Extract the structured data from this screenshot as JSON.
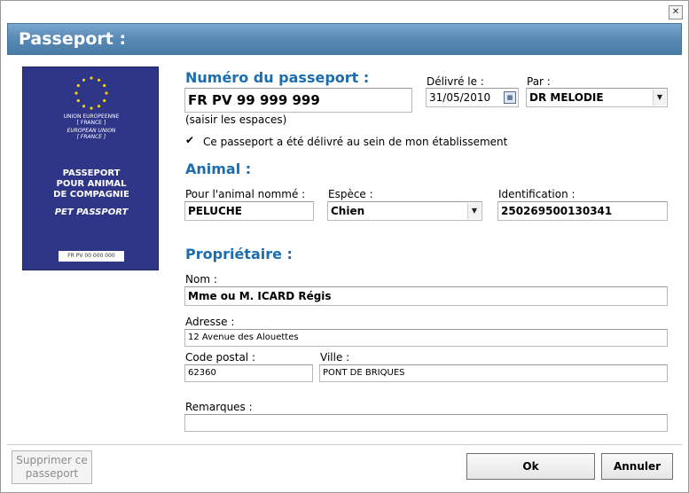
{
  "window": {
    "title": "Passeport :",
    "close_icon": "close-icon"
  },
  "passport_image": {
    "union_fr_1": "UNION EUROPEENNE",
    "union_fr_2": "[ FRANCE ]",
    "union_en_1": "EUROPEAN UNION",
    "union_en_2": "[ FRANCE ]",
    "title_1": "PASSEPORT",
    "title_2": "POUR ANIMAL",
    "title_3": "DE COMPAGNIE",
    "title_en": "PET PASSPORT",
    "number": "FR PV  00  000  000",
    "star_color": "#f5d500",
    "cover_color": "#2f3587"
  },
  "passport": {
    "section_title": "Numéro du passeport :",
    "number_value": "FR PV 99 999 999",
    "hint": "(saisir les espaces)",
    "issued_label": "Délivré le :",
    "issued_value": "31/05/2010",
    "by_label": "Par :",
    "by_value": "DR MELODIE",
    "checkbox_label": "Ce passeport a été délivré au sein de mon établissement",
    "checkbox_checked": true
  },
  "animal": {
    "section_title": "Animal :",
    "name_label": "Pour l'animal nommé :",
    "name_value": "PELUCHE",
    "species_label": "Espèce :",
    "species_value": "Chien",
    "id_label": "Identification :",
    "id_value": "250269500130341"
  },
  "owner": {
    "section_title": "Propriétaire :",
    "name_label": "Nom :",
    "name_value": "Mme ou M. ICARD Régis",
    "address_label": "Adresse :",
    "address_value": "12 Avenue des Alouettes",
    "postal_label": "Code postal :",
    "postal_value": "62360",
    "city_label": "Ville :",
    "city_value": "PONT DE BRIQUES",
    "remarks_label": "Remarques :",
    "remarks_value": ""
  },
  "buttons": {
    "delete_line1": "Supprimer ce",
    "delete_line2": "passeport",
    "ok": "Ok",
    "cancel": "Annuler"
  },
  "colors": {
    "section_blue": "#1c6dad",
    "title_bar": "#5a8bb7"
  }
}
